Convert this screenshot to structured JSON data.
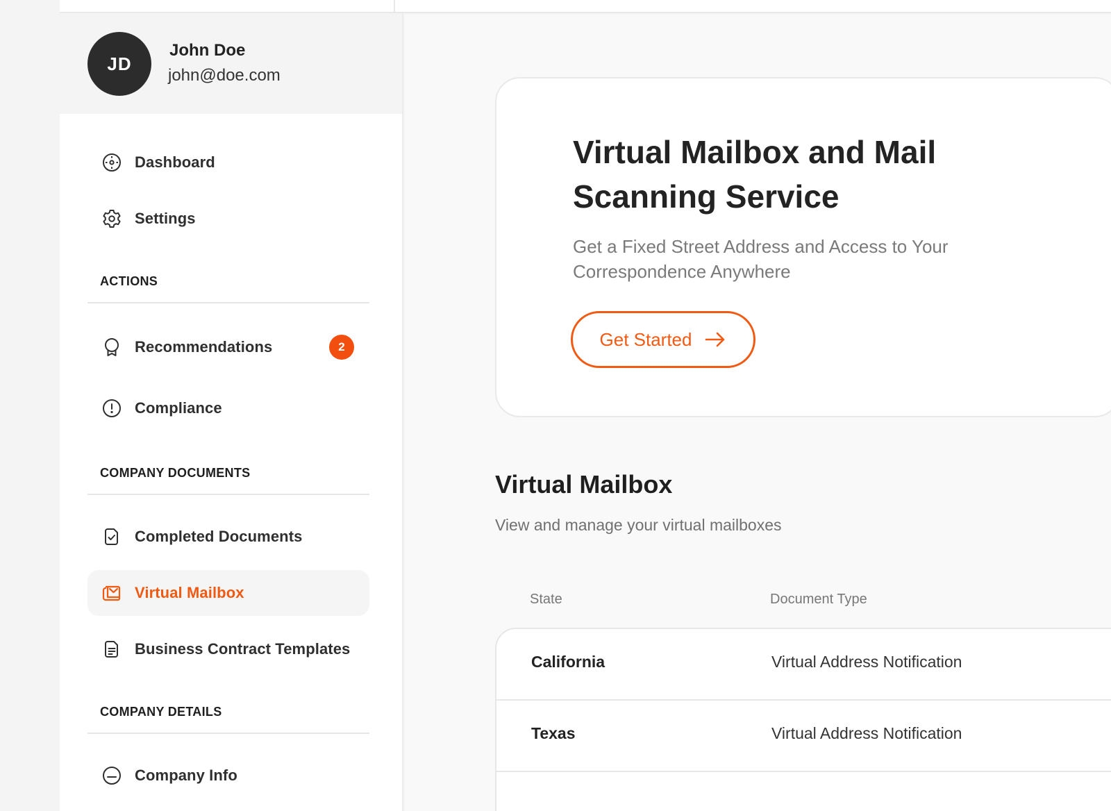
{
  "user": {
    "initials": "JD",
    "name": "John Doe",
    "email": "john@doe.com"
  },
  "sidebar": {
    "top_items": [
      {
        "label": "Dashboard",
        "icon": "dashboard-icon"
      },
      {
        "label": "Settings",
        "icon": "gear-icon"
      }
    ],
    "sections": [
      {
        "title": "ACTIONS",
        "items": [
          {
            "label": "Recommendations",
            "icon": "award-icon",
            "badge": "2"
          },
          {
            "label": "Compliance",
            "icon": "alert-circle-icon"
          }
        ]
      },
      {
        "title": "COMPANY DOCUMENTS",
        "items": [
          {
            "label": "Completed Documents",
            "icon": "document-check-icon"
          },
          {
            "label": "Virtual Mailbox",
            "icon": "mailbox-icon",
            "active": true
          },
          {
            "label": "Business Contract Templates",
            "icon": "document-lines-icon"
          }
        ]
      },
      {
        "title": "COMPANY DETAILS",
        "items": [
          {
            "label": "Company Info",
            "icon": "company-info-icon"
          }
        ]
      }
    ]
  },
  "hero": {
    "title": "Virtual Mailbox and Mail Scanning Service",
    "subtitle": "Get a Fixed Street Address and Access to Your Correspondence Anywhere",
    "cta_label": "Get Started",
    "cta_icon": "arrow-right-icon"
  },
  "mailbox": {
    "title": "Virtual Mailbox",
    "subtitle": "View and manage your virtual mailboxes",
    "columns": [
      "State",
      "Document Type"
    ],
    "rows": [
      {
        "state": "California",
        "document_type": "Virtual Address Notification"
      },
      {
        "state": "Texas",
        "document_type": "Virtual Address Notification"
      }
    ]
  },
  "colors": {
    "accent": "#f05a12",
    "badge": "#f24e0f",
    "avatar_bg": "#2c2c2c"
  }
}
